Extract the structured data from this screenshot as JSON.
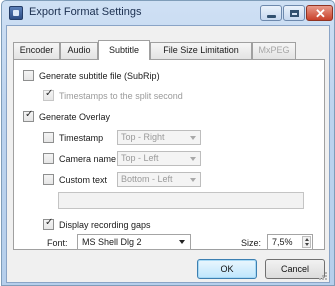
{
  "window": {
    "title": "Export Format Settings"
  },
  "tabs": [
    {
      "label": "Encoder",
      "active": false,
      "enabled": true
    },
    {
      "label": "Audio",
      "active": false,
      "enabled": true
    },
    {
      "label": "Subtitle",
      "active": true,
      "enabled": true
    },
    {
      "label": "File Size Limitation",
      "active": false,
      "enabled": true
    },
    {
      "label": "MxPEG",
      "active": false,
      "enabled": false
    }
  ],
  "subtitle_panel": {
    "generate_subtitle": {
      "label": "Generate subtitle file (SubRip)",
      "checked": false
    },
    "timestamps_split": {
      "label": "Timestamps to the split second",
      "checked": true,
      "enabled": false
    },
    "generate_overlay": {
      "label": "Generate Overlay",
      "checked": true
    },
    "overlay_items": [
      {
        "label": "Timestamp",
        "checked": false,
        "position": "Top - Right"
      },
      {
        "label": "Camera name",
        "checked": false,
        "position": "Top - Left"
      },
      {
        "label": "Custom text",
        "checked": false,
        "position": "Bottom - Left"
      }
    ],
    "custom_text_value": "",
    "display_gaps": {
      "label": "Display recording gaps",
      "checked": true
    },
    "font": {
      "label": "Font:",
      "value": "MS Shell Dlg 2"
    },
    "size": {
      "label": "Size:",
      "value": "7,5%"
    }
  },
  "buttons": {
    "ok": "OK",
    "cancel": "Cancel"
  },
  "colors": {
    "titlebar": "#bcd3ee",
    "close_button": "#c8412a",
    "panel_bg": "#ffffff",
    "dialog_bg": "#f0f0f0"
  }
}
